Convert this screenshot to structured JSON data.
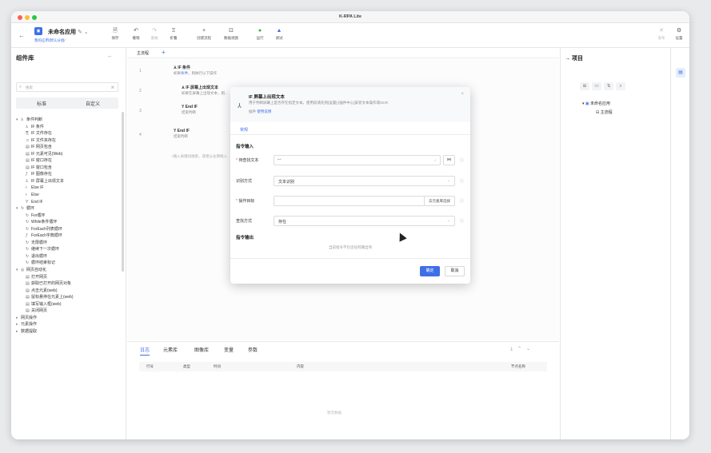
{
  "window": {
    "title": "K-RPA Lite"
  },
  "app": {
    "name": "未命名应用",
    "path": "我的应用/默认分组/",
    "icon": "app-icon"
  },
  "toolbar": {
    "buttons": [
      {
        "label": "保存",
        "icon": "save-icon"
      },
      {
        "label": "撤销",
        "icon": "undo-icon"
      },
      {
        "label": "重做",
        "icon": "redo-icon"
      },
      {
        "label": "折叠",
        "icon": "collapse-icon"
      },
      {
        "label": "创建流程",
        "icon": "create-flow-icon"
      },
      {
        "label": "数据视图",
        "icon": "data-view-icon"
      },
      {
        "label": "运行",
        "icon": "run-icon"
      },
      {
        "label": "调试",
        "icon": "debug-icon"
      }
    ],
    "right": [
      {
        "label": "发布",
        "icon": "publish-icon"
      },
      {
        "label": "设置",
        "icon": "settings-icon"
      }
    ]
  },
  "left_panel": {
    "title": "组件库",
    "search_placeholder": "搜索",
    "search_kbd": "⌘",
    "tabs": [
      "标准",
      "自定义"
    ],
    "tree": [
      {
        "label": "条件判断",
        "group": true
      },
      {
        "label": "IF 条件"
      },
      {
        "label": "IF 文件存在"
      },
      {
        "label": "IF 文件夹存在"
      },
      {
        "label": "IF 网页包含"
      },
      {
        "label": "IF 元素可见(Web)"
      },
      {
        "label": "IF 窗口存在"
      },
      {
        "label": "IF 窗口包含"
      },
      {
        "label": "IF 图像存在"
      },
      {
        "label": "IF 屏幕上出现文本"
      },
      {
        "label": "Else IF"
      },
      {
        "label": "Else"
      },
      {
        "label": "End IF"
      },
      {
        "label": "循环",
        "group": true
      },
      {
        "label": "For循环"
      },
      {
        "label": "While条件循环"
      },
      {
        "label": "ForEach列表循环"
      },
      {
        "label": "ForEach字典循环"
      },
      {
        "label": "无限循环"
      },
      {
        "label": "继续下一次循环"
      },
      {
        "label": "退出循环"
      },
      {
        "label": "循环结束标记"
      },
      {
        "label": "网页自动化",
        "group": true
      },
      {
        "label": "打开网页"
      },
      {
        "label": "获取已打开的网页对象"
      },
      {
        "label": "点击元素(web)"
      },
      {
        "label": "鼠标悬停在元素上(web)"
      },
      {
        "label": "填写输入框(web)"
      },
      {
        "label": "关闭网页"
      },
      {
        "label": "网页操作",
        "group": true,
        "collapsed": true
      },
      {
        "label": "元素操作",
        "group": true,
        "collapsed": true
      },
      {
        "label": "数据提取",
        "group": true,
        "collapsed": true
      }
    ]
  },
  "flow": {
    "tab": "主流程",
    "line_numbers": [
      "1",
      "2",
      "3",
      "4"
    ],
    "nodes": [
      {
        "title": "IF 条件",
        "sub_pre": "如果",
        "sub_link": "条件",
        "sub_post": "，则执行以下操作"
      },
      {
        "title": "IF 屏幕上出现文本",
        "sub": "如果在屏幕上出现文本，则..."
      },
      {
        "title": "End IF",
        "sub": "结束判断"
      },
      {
        "title": "End IF",
        "sub": "结束判断"
      }
    ],
    "hint": "+输入关键词搜索，或者从左侧拖入"
  },
  "bottom": {
    "tabs": [
      "日志",
      "元素库",
      "图像库",
      "变量",
      "参数"
    ],
    "columns": [
      "行号",
      "类型",
      "时间",
      "内容",
      "节点名称"
    ],
    "empty": "暂无数据"
  },
  "right_panel": {
    "title": "项目",
    "tree": [
      {
        "label": "未命名应用"
      },
      {
        "label": "主流程"
      }
    ]
  },
  "modal": {
    "title": "IF 屏幕上出现文本",
    "desc": "用于判断屏幕上是否存在指定文本。使用前请先到[设置]-[插件中心]安装文本操作或OCR",
    "desc2_pre": "插件",
    "desc2_link": "使用说明",
    "tab": "常规",
    "section_input": "指令输入",
    "section_output": "指令输出",
    "fields": {
      "text_label": "待查找文本",
      "method_label": "识别方式",
      "method_value": "文本识别",
      "target_label": "操作目标",
      "target_pick": "去元素库选择",
      "find_label": "查找方式",
      "find_value": "存在"
    },
    "output_empty": "当前指令不包含任何输出项",
    "ok": "确定",
    "cancel": "取消"
  }
}
